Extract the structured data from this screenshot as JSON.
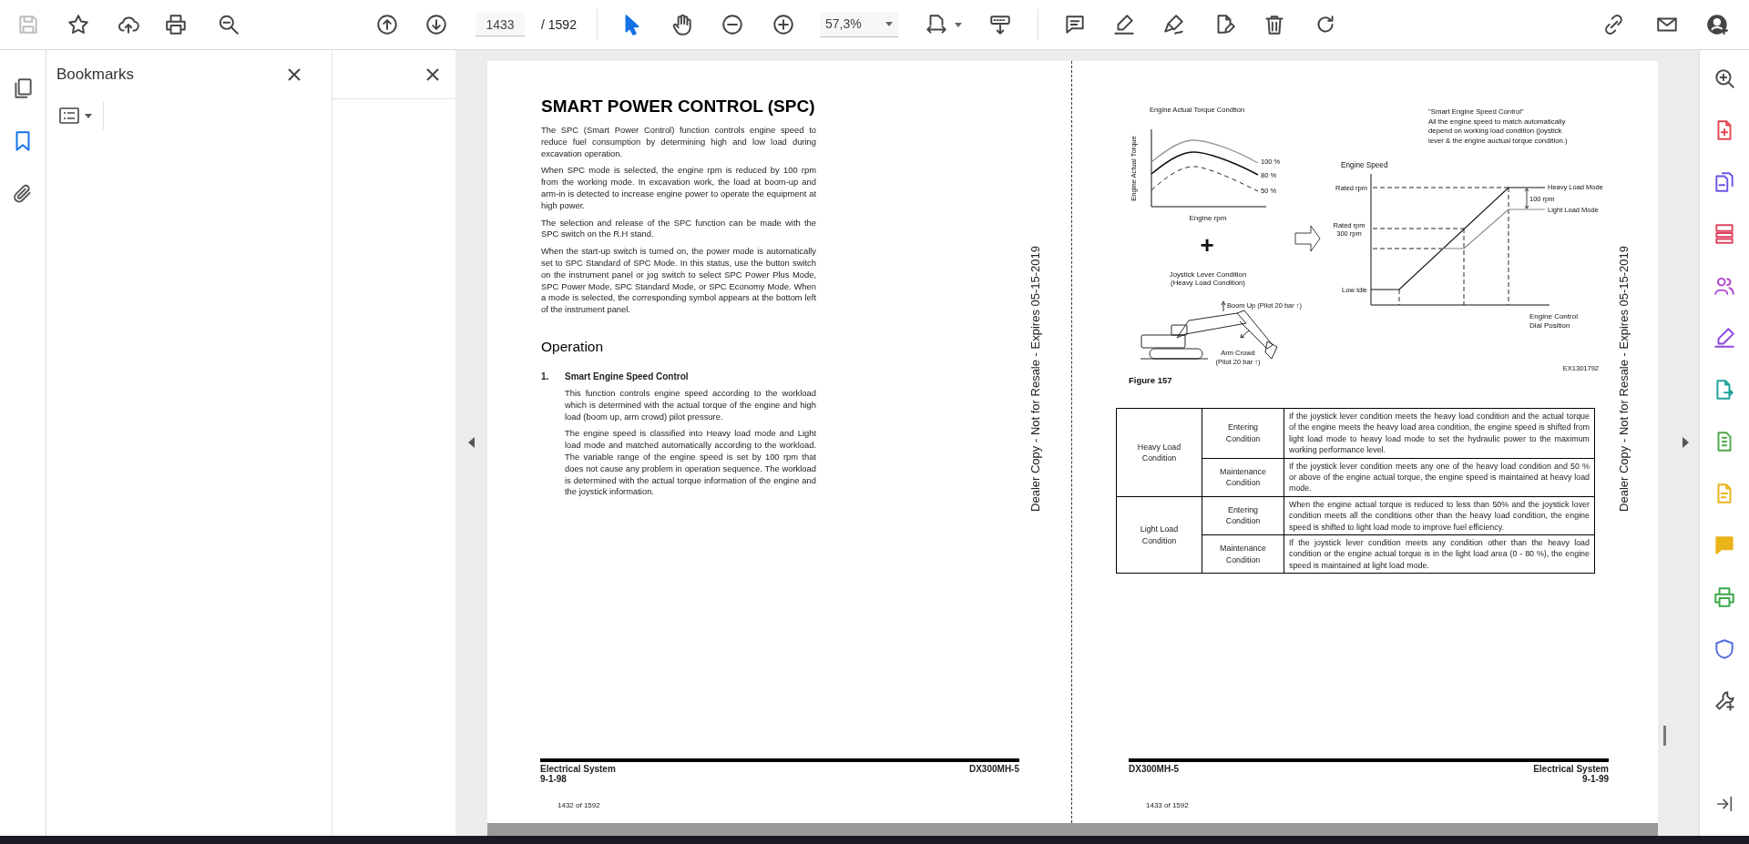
{
  "toolbar": {
    "page_field": "1433",
    "page_total": "/ 1592",
    "zoom_field": "57,3%",
    "save_disabled": true
  },
  "nav_rail": [
    {
      "kind": "pages",
      "selected": false
    },
    {
      "kind": "bookmarks",
      "selected": true
    },
    {
      "kind": "attachments",
      "selected": false
    }
  ],
  "bookmarks_panel": {
    "title": "Bookmarks"
  },
  "pages": [
    {
      "heading": "SMART POWER CONTROL (SPC)",
      "paragraphs": [
        "The SPC (Smart Power Control) function controls engine speed to reduce fuel consumption by determining high and low load during excavation operation.",
        "When SPC mode is selected, the engine rpm is reduced by 100 rpm from the working mode. In excavation work, the load at boom-up and arm-in is detected to increase engine power to operate the equipment at high power.",
        "The selection and release of the SPC function can be made with the SPC switch on the R.H stand.",
        "When the start-up switch is turned on, the power mode is automatically set to SPC Standard of SPC Mode. In this status, use the button switch on the instrument panel or jog switch to select SPC Power Plus Mode, SPC Power Mode, SPC Standard Mode, or SPC Economy Mode. When a mode is selected, the corresponding symbol appears at the bottom left of the instrument panel."
      ],
      "section_heading": "Operation",
      "item": {
        "number": "1.",
        "title": "Smart Engine Speed Control",
        "paragraphs": [
          "This function controls engine speed according to the workload which is determined with the actual torque of the engine and high load (boom up, arm crowd) pilot pressure.",
          "The engine speed is classified into Heavy load mode and Light load mode and matched automatically according to the workload. The variable range of the engine speed is set by 100 rpm that does not cause any problem in operation sequence. The workload is determined with the actual torque information of the engine and the joystick information."
        ]
      },
      "notice": "Dealer Copy - Not for Resale - Expires 05-15-2019",
      "footer": {
        "left": [
          "Electrical System",
          "9-1-98"
        ],
        "right": [
          "DX300MH-5"
        ],
        "page_count": "1432 of 1592"
      }
    },
    {
      "figure": {
        "torque_chart": {
          "title": "Engine Actual Torque Condtion",
          "y_label": "Engine Actual Torque",
          "x_label": "Engine rpm",
          "curve_labels": [
            "100 %",
            "80 %",
            "50 %"
          ]
        },
        "plus": "+",
        "joystick": {
          "title_lines": [
            "Joystick Lever Condition",
            "(Heavy Load Condition)"
          ],
          "boom_label": "Boom Up (Pilot 20 bar ↑)",
          "arm_label_lines": [
            "Arm Crowd",
            "(Pilot 20 bar ↑)"
          ]
        },
        "speed_chart": {
          "note_lines": [
            "\"Smart Engine Speed Control\"",
            "All the engine speed to match automatically",
            "depend on working load condition (joystick",
            "lever & the engine auctual torque condition.)"
          ],
          "y_label": "Engine Speed",
          "rated": "Rated rpm",
          "rated_minus_lines": [
            "Rated rpm",
            "300 rpm"
          ],
          "low_idle": "Low Idle",
          "heavy_mode": "Heavy Load Mode",
          "light_mode": "Light Load Mode",
          "offset": "100 rpm",
          "x_label_lines": [
            "Engine Control",
            "Dial Position"
          ]
        },
        "code": "EX1301792",
        "caption": "Figure 157"
      },
      "table": [
        {
          "condition": "Heavy Load Condition",
          "rows": [
            {
              "phase": "Entering Condition",
              "text": "If the joystick lever condition meets the heavy load condition and the actual torque of the engine meets the heavy load area condition, the engine speed is shifted from light load mode to heavy load mode to set the hydraulic power to the maximum working performance level."
            },
            {
              "phase": "Maintenance Condition",
              "text": "If the joystick lever condition meets any one of the heavy load condition and 50 % or above of the engine actual torque, the engine speed is maintained at heavy load mode."
            }
          ]
        },
        {
          "condition": "Light Load Condition",
          "rows": [
            {
              "phase": "Entering Condition",
              "text": "When the engine actual torque is reduced to less than 50% and the joystick lover condition meets all the conditions other than the heavy load condition, the engine speed is shifted to light load mode to improve fuel efficiency."
            },
            {
              "phase": "Maintenance Condition",
              "text": "If the joystick lever condition meets any condition other than the heavy load condition or the engine actual torque is in the light load area (0 - 80 %), the engine speed is maintained at light load mode."
            }
          ]
        }
      ],
      "notice": "Dealer Copy - Not for Resale - Expires 05-15-2019",
      "footer": {
        "left": [
          "DX300MH-5"
        ],
        "right": [
          "Electrical System",
          "9-1-99"
        ],
        "page_count": "1433 of 1592"
      }
    }
  ]
}
